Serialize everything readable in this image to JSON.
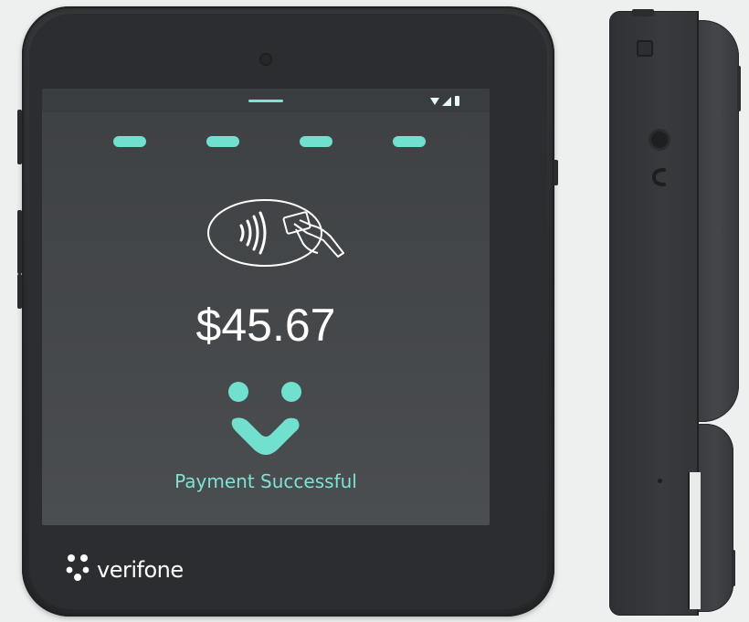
{
  "screen": {
    "amount": "$45.67",
    "status_message": "Payment Successful",
    "progress_steps_completed": 4,
    "progress_steps_total": 4
  },
  "brand": {
    "name": "verifone"
  },
  "colors": {
    "accent": "#72e0cf",
    "amount_text": "#ffffff",
    "screen_bg": "#43464a",
    "device_body": "#2f3134",
    "background": "#eeefef"
  },
  "icons": {
    "status_bar": [
      "wifi-icon",
      "signal-icon",
      "battery-icon"
    ],
    "contactless": "contactless-tap-icon",
    "success": "verifone-checkmark-icon",
    "brand_mark": "verifone-logo-icon"
  }
}
